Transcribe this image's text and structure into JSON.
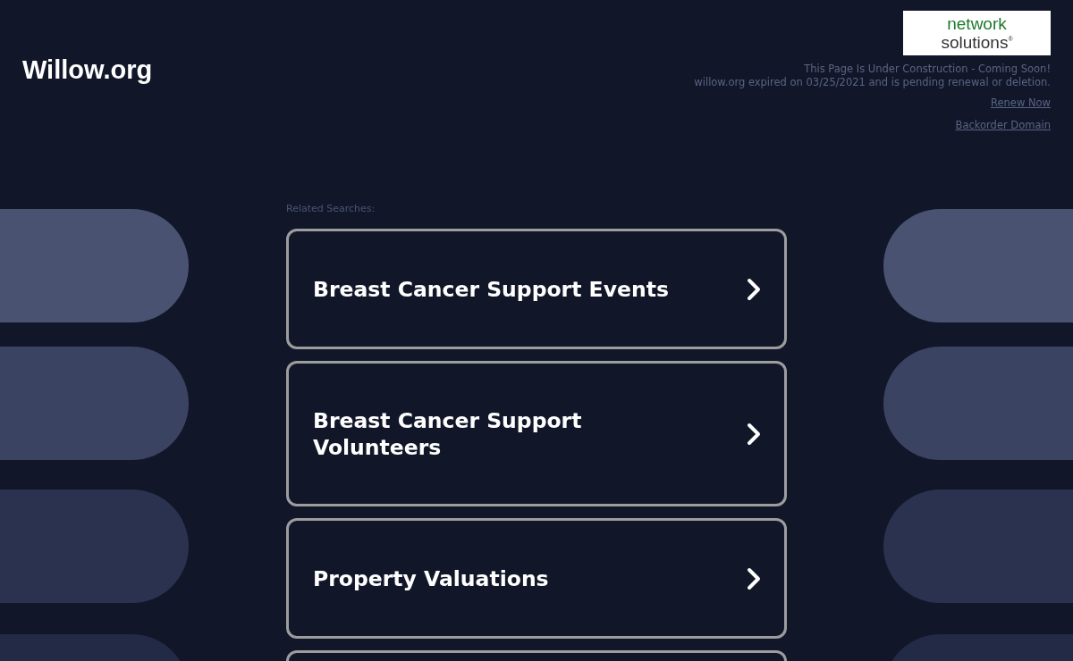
{
  "site_title": "Willow.org",
  "logo": {
    "line_1": "network",
    "line_2": "solutions",
    "mark": "®"
  },
  "notice": {
    "line_1": "This Page Is Under Construction - Coming Soon!",
    "line_2": "willow.org expired on 03/25/2021 and is pending renewal or deletion."
  },
  "links": [
    "Renew Now",
    "Backorder Domain"
  ],
  "related_label": "Related Searches:",
  "results": [
    {
      "kind": "link",
      "label": "Breast Cancer Support Events"
    },
    {
      "kind": "link",
      "label": "Breast Cancer Support Volunteers"
    },
    {
      "kind": "link",
      "label": "Property Valuations"
    },
    {
      "kind": "cut_off"
    }
  ]
}
